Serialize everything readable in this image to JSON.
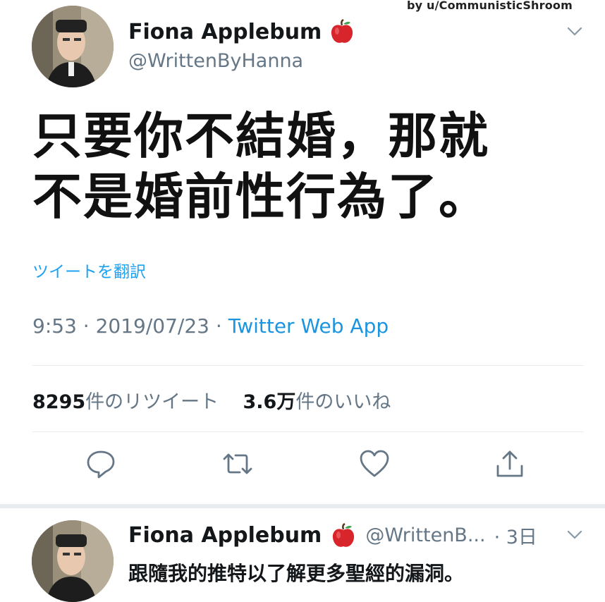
{
  "watermark": "by u/CommunisticShroom",
  "tweet": {
    "display_name": "Fiona Applebum",
    "handle": "@WrittenByHanna",
    "text_line1": "只要你不結婚，那就",
    "text_line2": "不是婚前性行為了。",
    "translate_link": "ツイートを翻訳",
    "time": "9:53",
    "separator": "·",
    "date": "2019/07/23",
    "source": "Twitter Web App",
    "retweet_count": "8295",
    "retweet_label": "件のリツイート",
    "like_count": "3.6万",
    "like_label": "件のいいね"
  },
  "reply": {
    "display_name": "Fiona Applebum",
    "handle": "@WrittenB...",
    "age": "· 3日",
    "text": "跟隨我的推特以了解更多聖經的漏洞。"
  },
  "icons": {
    "name_badge": "red-apple-icon",
    "menu": "chevron-down-icon",
    "reply": "reply-icon",
    "retweet": "retweet-icon",
    "like": "heart-icon",
    "share": "share-icon"
  },
  "colors": {
    "link": "#1da1f2",
    "secondary_text": "#657786",
    "apple_red": "#d8252c"
  }
}
